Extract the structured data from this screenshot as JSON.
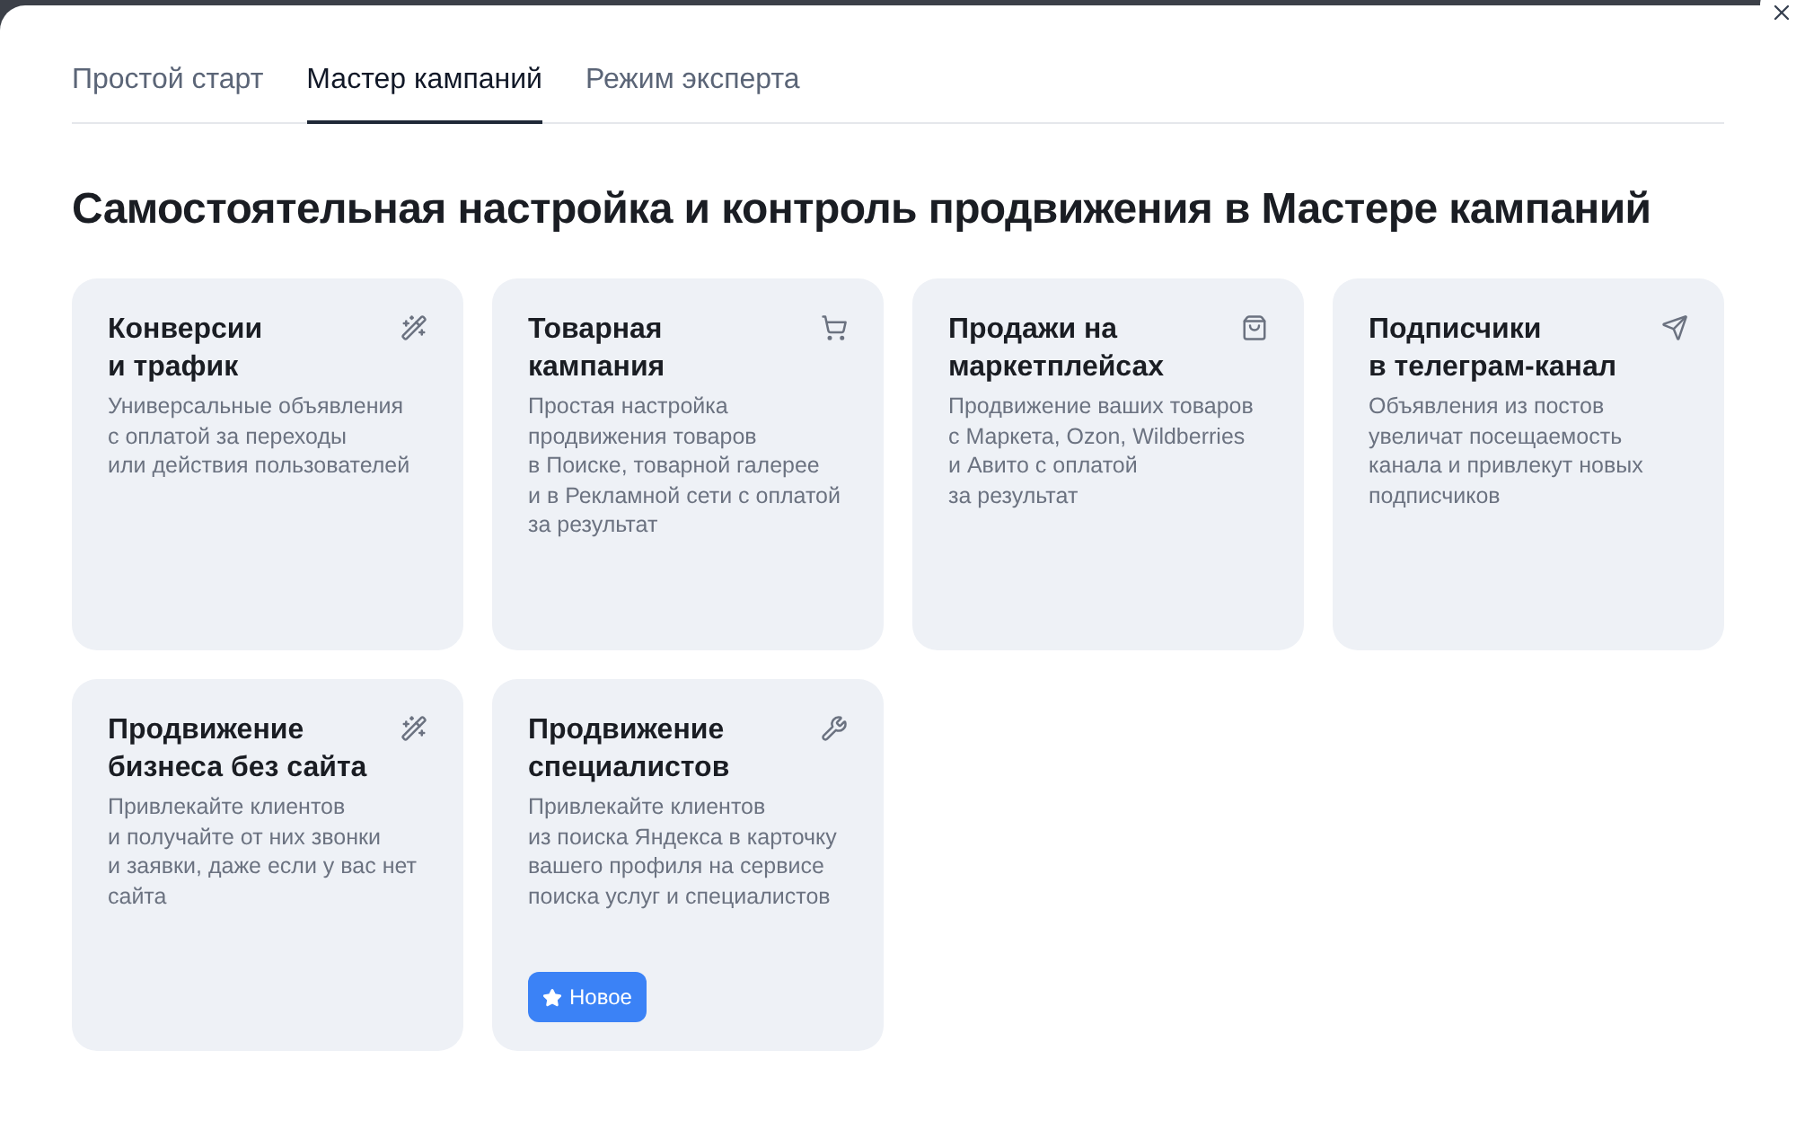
{
  "tabs": [
    {
      "label": "Простой старт",
      "selected": false
    },
    {
      "label": "Мастер кампаний",
      "selected": true
    },
    {
      "label": "Режим эксперта",
      "selected": false
    }
  ],
  "heading": "Самостоятельная настройка и контроль продвижения в Мастере кампаний",
  "cards": [
    {
      "title": "Конверсии\nи трафик",
      "description": "Универсальные объявления\nс оплатой за переходы\nили действия пользователей"
    },
    {
      "title": "Товарная\nкампания",
      "description": "Простая настройка\nпродвижения товаров\nв Поиске, товарной галерее\nи в Рекламной сети с оплатой\nза результат"
    },
    {
      "title": "Продажи на\nмаркетплейсах",
      "description": "Продвижение ваших товаров\nс Маркета, Ozon, Wildberries\nи Авито с оплатой\nза результат"
    },
    {
      "title": "Подписчики\nв телеграм-канал",
      "description": "Объявления из постов\nувеличат посещаемость\nканала и привлекут новых\nподписчиков"
    },
    {
      "title": "Продвижение\nбизнеса без сайта",
      "description": "Привлекайте клиентов\nи получайте от них звонки\nи заявки, даже если у вас нет\nсайта"
    },
    {
      "title": "Продвижение\nспециалистов",
      "description": "Привлекайте клиентов\nиз поиска Яндекса в карточку\nвашего профиля на сервисе\nпоиска услуг и специалистов",
      "badge": "Новое"
    }
  ]
}
